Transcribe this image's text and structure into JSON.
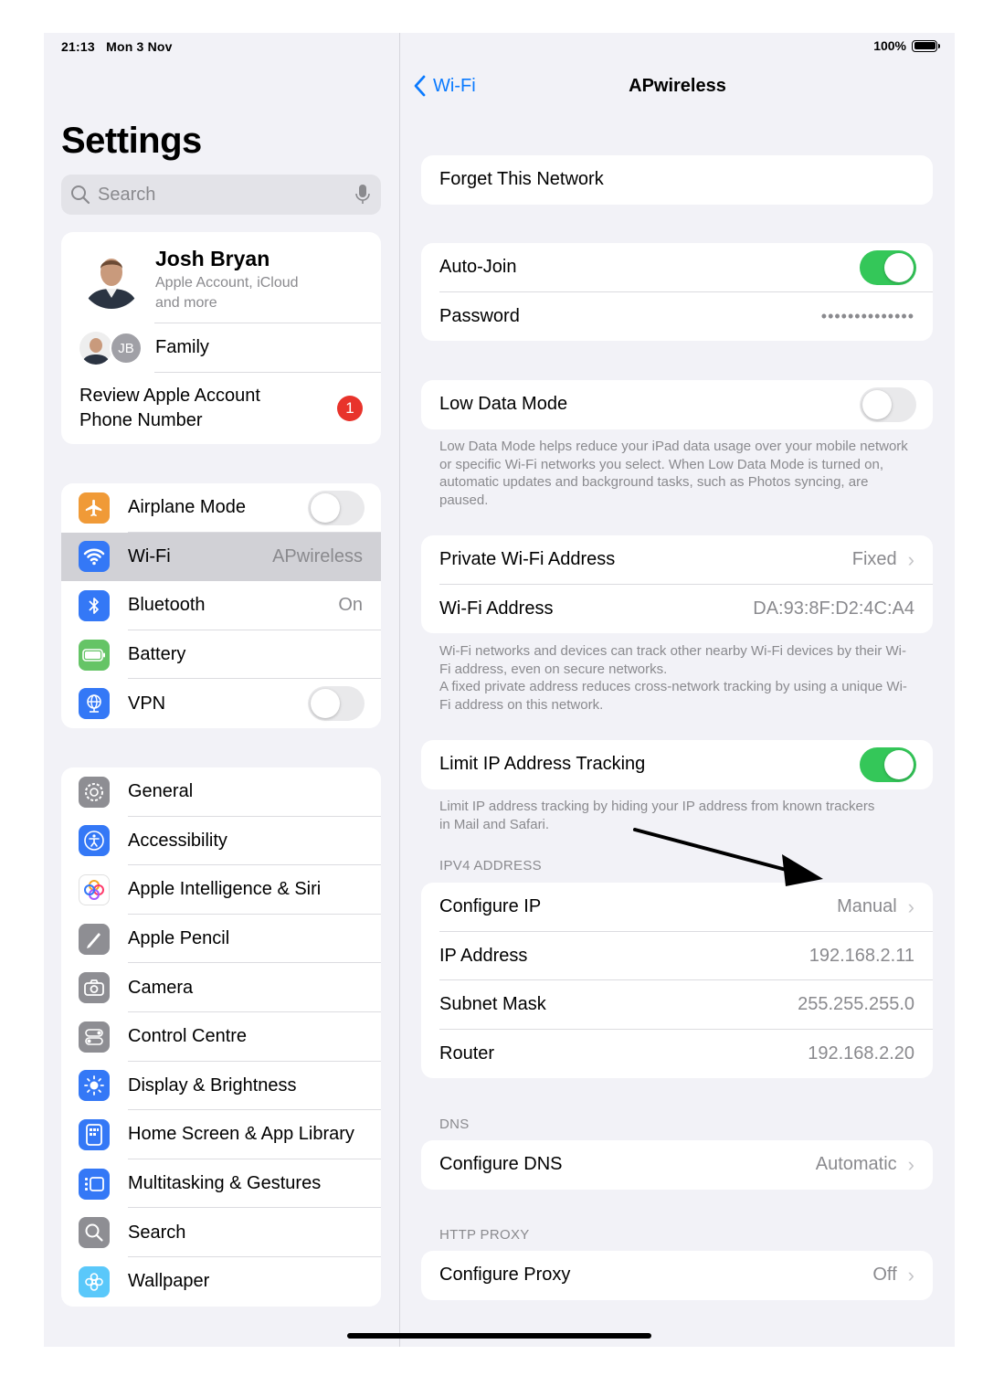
{
  "status": {
    "time": "21:13",
    "date": "Mon 3 Nov",
    "battery": "100%"
  },
  "sidebar": {
    "title": "Settings",
    "search_placeholder": "Search",
    "account": {
      "name": "Josh Bryan",
      "subtitle_line1": "Apple Account, iCloud",
      "subtitle_line2": "and more",
      "initials": "JB"
    },
    "family_label": "Family",
    "review": {
      "line1": "Review Apple Account",
      "line2": "Phone Number",
      "badge": "1"
    },
    "connectivity": [
      {
        "label": "Airplane Mode",
        "icon": "airplane-icon",
        "color": "#f09a37",
        "toggle": false
      },
      {
        "label": "Wi-Fi",
        "icon": "wifi-icon",
        "color": "#3478f6",
        "value": "APwireless",
        "selected": true
      },
      {
        "label": "Bluetooth",
        "icon": "bluetooth-icon",
        "color": "#3478f6",
        "value": "On"
      },
      {
        "label": "Battery",
        "icon": "battery-icon",
        "color": "#65c466"
      },
      {
        "label": "VPN",
        "icon": "globe-icon",
        "color": "#3478f6",
        "toggle": false
      }
    ],
    "general": [
      {
        "label": "General",
        "icon": "gear-icon",
        "color": "#8e8e93"
      },
      {
        "label": "Accessibility",
        "icon": "accessibility-icon",
        "color": "#3478f6"
      },
      {
        "label": "Apple Intelligence & Siri",
        "icon": "apple-intelligence-icon",
        "color": "#ffffff"
      },
      {
        "label": "Apple Pencil",
        "icon": "pencil-icon",
        "color": "#8e8e93"
      },
      {
        "label": "Camera",
        "icon": "camera-icon",
        "color": "#8e8e93"
      },
      {
        "label": "Control Centre",
        "icon": "control-centre-icon",
        "color": "#8e8e93"
      },
      {
        "label": "Display & Brightness",
        "icon": "sun-icon",
        "color": "#3478f6"
      },
      {
        "label": "Home Screen & App Library",
        "icon": "home-screen-icon",
        "color": "#3478f6"
      },
      {
        "label": "Multitasking & Gestures",
        "icon": "multitasking-icon",
        "color": "#3478f6"
      },
      {
        "label": "Search",
        "icon": "search-icon",
        "color": "#8e8e93"
      },
      {
        "label": "Wallpaper",
        "icon": "wallpaper-icon",
        "color": "#5ac8fa"
      }
    ]
  },
  "detail": {
    "back_label": "Wi-Fi",
    "title": "APwireless",
    "forget": "Forget This Network",
    "auto_join": {
      "label": "Auto-Join",
      "on": true
    },
    "password": {
      "label": "Password",
      "value": "••••••••••••••"
    },
    "low_data": {
      "label": "Low Data Mode",
      "on": false,
      "footnote": "Low Data Mode helps reduce your iPad data usage over your mobile network or specific Wi-Fi networks you select. When Low Data Mode is turned on, automatic updates and background tasks, such as Photos syncing, are paused."
    },
    "private_address": {
      "label": "Private Wi-Fi Address",
      "value": "Fixed"
    },
    "wifi_address": {
      "label": "Wi-Fi Address",
      "value": "DA:93:8F:D2:4C:A4"
    },
    "address_footnote_1": "Wi-Fi networks and devices can track other nearby Wi-Fi devices by their Wi-Fi address, even on secure networks.",
    "address_footnote_2": "A fixed private address reduces cross-network tracking by using a unique Wi-Fi address on this network.",
    "limit_ip": {
      "label": "Limit IP Address Tracking",
      "on": true,
      "footnote": "Limit IP address tracking by hiding your IP address from known trackers in Mail and Safari."
    },
    "ipv4_header": "IPV4 ADDRESS",
    "ipv4": [
      {
        "label": "Configure IP",
        "value": "Manual",
        "chevron": true
      },
      {
        "label": "IP Address",
        "value": "192.168.2.11"
      },
      {
        "label": "Subnet Mask",
        "value": "255.255.255.0"
      },
      {
        "label": "Router",
        "value": "192.168.2.20"
      }
    ],
    "dns_header": "DNS",
    "dns": {
      "label": "Configure DNS",
      "value": "Automatic"
    },
    "proxy_header": "HTTP PROXY",
    "proxy": {
      "label": "Configure Proxy",
      "value": "Off"
    }
  }
}
